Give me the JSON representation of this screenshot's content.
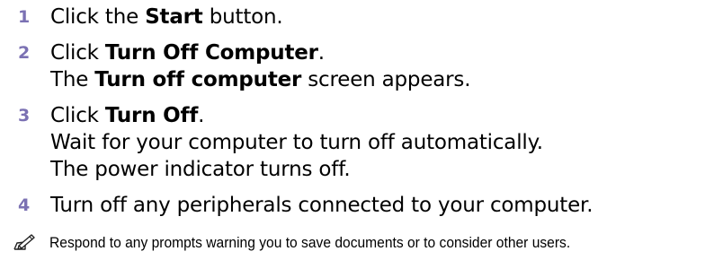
{
  "steps": [
    {
      "number": "1",
      "lines": [
        [
          "Click the ",
          "Start",
          " button."
        ]
      ]
    },
    {
      "number": "2",
      "lines": [
        [
          "Click ",
          "Turn Off Computer",
          "."
        ],
        [
          "The ",
          "Turn off computer",
          " screen appears."
        ]
      ]
    },
    {
      "number": "3",
      "lines": [
        [
          "Click ",
          "Turn Off",
          "."
        ],
        [
          "Wait for your computer to turn off automatically."
        ],
        [
          "The power indicator turns off."
        ]
      ]
    },
    {
      "number": "4",
      "lines": [
        [
          "Turn off any peripherals connected to your computer."
        ]
      ]
    }
  ],
  "note": {
    "icon": "pencil-note-icon",
    "text": "Respond to any prompts warning you to save documents or to consider other users."
  }
}
